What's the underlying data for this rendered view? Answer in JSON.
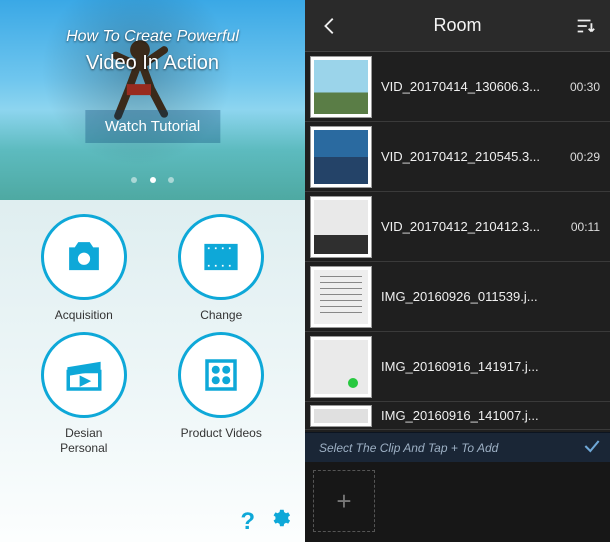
{
  "hero": {
    "subtitle": "How To Create Powerful",
    "title": "Video In Action",
    "watch_label": "Watch Tutorial"
  },
  "tiles": {
    "acquisition": {
      "label": "Acquisition"
    },
    "change": {
      "label": "Change"
    },
    "design": {
      "label": "Desian\nPersonal"
    },
    "product": {
      "label": "Product Videos"
    }
  },
  "room": {
    "title": "Room",
    "hint": "Select The Clip And Tap + To Add",
    "add_label": "+",
    "items": [
      {
        "name": "VID_20170414_130606.3...",
        "duration": "00:30",
        "thumb": "sky"
      },
      {
        "name": "VID_20170412_210545.3...",
        "duration": "00:29",
        "thumb": "city"
      },
      {
        "name": "VID_20170412_210412.3...",
        "duration": "00:11",
        "thumb": "grey"
      },
      {
        "name": "IMG_20160926_011539.j...",
        "duration": "",
        "thumb": "note"
      },
      {
        "name": "IMG_20160916_141917.j...",
        "duration": "",
        "thumb": "phone"
      },
      {
        "name": "IMG_20160916_141007.j...",
        "duration": "",
        "thumb": "plain"
      }
    ]
  }
}
